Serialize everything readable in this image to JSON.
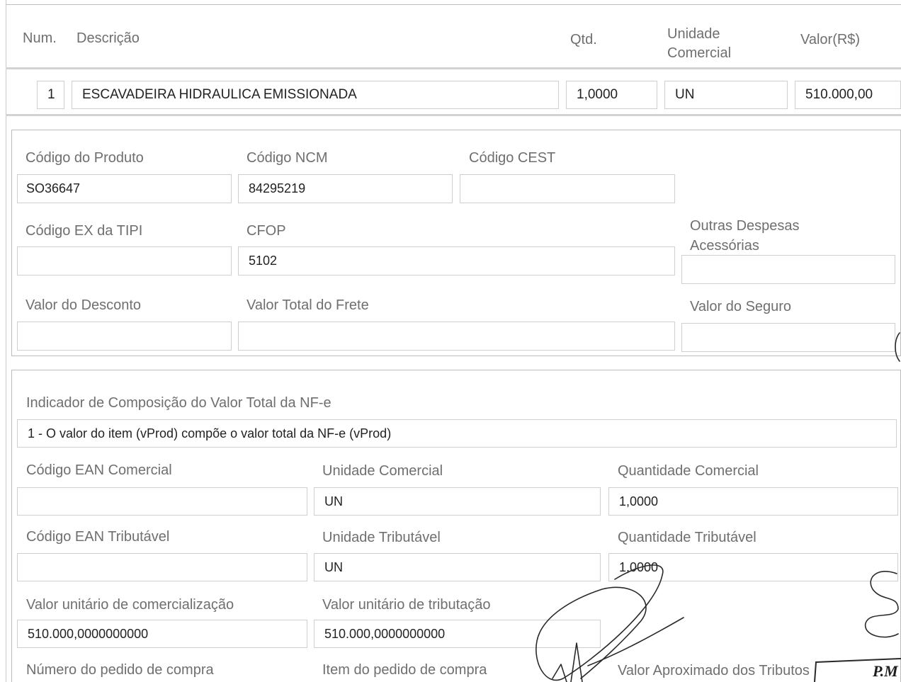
{
  "header": {
    "num": "Num.",
    "descricao": "Descrição",
    "qtd": "Qtd.",
    "unidade_line1": "Unidade",
    "unidade_line2": "Comercial",
    "valor": "Valor(R$)"
  },
  "item": {
    "num": "1",
    "descricao": "ESCAVADEIRA HIDRAULICA EMISSIONADA",
    "qtd": "1,0000",
    "unidade": "UN",
    "valor": "510.000,00"
  },
  "details": {
    "codigo_produto": {
      "label": "Código do Produto",
      "value": "SO36647"
    },
    "codigo_ncm": {
      "label": "Código NCM",
      "value": "84295219"
    },
    "codigo_cest": {
      "label": "Código CEST",
      "value": ""
    },
    "codigo_ex_tipi": {
      "label": "Código EX da TIPI",
      "value": ""
    },
    "cfop": {
      "label": "CFOP",
      "value": "5102"
    },
    "outras_despesas": {
      "label_line1": "Outras Despesas",
      "label_line2": "Acessórias",
      "value": ""
    },
    "valor_desconto": {
      "label": "Valor do Desconto",
      "value": ""
    },
    "valor_frete": {
      "label": "Valor Total do Frete",
      "value": ""
    },
    "valor_seguro": {
      "label": "Valor do Seguro",
      "value": ""
    }
  },
  "composicao": {
    "indicador": {
      "label": "Indicador de Composição do Valor Total da NF-e",
      "value": "1 - O valor do item (vProd) compõe o valor total da NF-e (vProd)"
    },
    "ean_comercial": {
      "label": "Código EAN Comercial",
      "value": ""
    },
    "unidade_comercial": {
      "label": "Unidade Comercial",
      "value": "UN"
    },
    "quantidade_comercial": {
      "label": "Quantidade Comercial",
      "value": "1,0000"
    },
    "ean_tributavel": {
      "label": "Código EAN Tributável",
      "value": ""
    },
    "unidade_tributavel": {
      "label": "Unidade Tributável",
      "value": "UN"
    },
    "quantidade_tributavel": {
      "label": "Quantidade Tributável",
      "value": "1,0000"
    },
    "valor_unit_comercializacao": {
      "label": "Valor unitário de comercialização",
      "value": "510.000,0000000000"
    },
    "valor_unit_tributacao": {
      "label": "Valor unitário de tributação",
      "value": "510.000,0000000000"
    },
    "numero_pedido": {
      "label": "Número do pedido de compra"
    },
    "item_pedido": {
      "label": "Item do pedido de compra"
    },
    "valor_aprox_tributos": {
      "label": "Valor Aproximado dos Tributos"
    }
  },
  "stamp": {
    "text": "P.M"
  }
}
